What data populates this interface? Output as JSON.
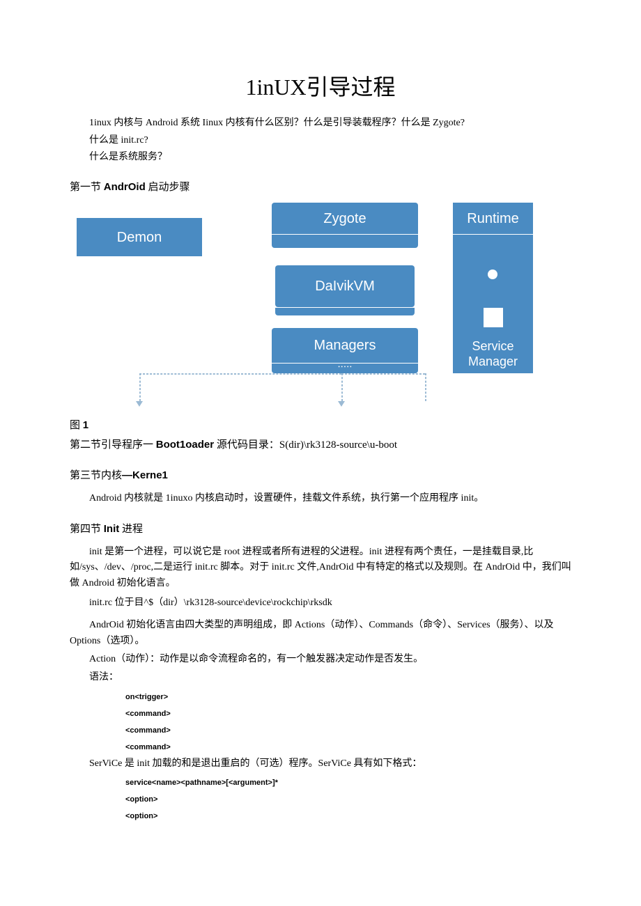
{
  "title": "1inUX引导过程",
  "intro": {
    "line1": "1inux 内核与 Android 系统 Iinux 内核有什么区别？什么是引导装载程序？什么是 Zygote?",
    "line2": "什么是 init.rc?",
    "line3": "什么是系统服务？"
  },
  "section1": {
    "prefix": "第一节 ",
    "bold": "AndrOid",
    "suffix": " 启动步骤"
  },
  "diagram": {
    "demon": "Demon",
    "zygote": "Zygote",
    "dalvik": "DaIvikVM",
    "managers": "Managers",
    "runtime": "Runtime",
    "service": "Service",
    "manager": "Manager"
  },
  "fig1": {
    "prefix": "图 ",
    "bold": "1"
  },
  "section2": {
    "prefix": "第二节引导程序一 ",
    "bold": "Boot1oader",
    "suffix": " 源代码目录：S(dir)\\rk3128-source\\u-boot"
  },
  "section3": {
    "prefix": "第三节内核",
    "bold": "—Kerne1"
  },
  "section3_body": "Android 内核就是 1inuxo 内核启动时，设置硬件，挂载文件系统，执行第一个应用程序 init。",
  "section4": {
    "prefix": "第四节 ",
    "bold": "Init",
    "suffix": " 进程"
  },
  "section4_p1": "init 是第一个进程，可以说它是 root 进程或者所有进程的父进程。init 进程有两个责任，一是挂载目录,比如/sys、/dev、/proc,二是运行 init.rc 脚本。对于 init.rc 文件,AndrOid 中有特定的格式以及规则。在 AndrOid 中，我们叫做 Android 初始化语言。",
  "section4_p2": "init.rc 位于目^$（dir）\\rk3128-source\\device\\rockchip\\rksdk",
  "section4_p3": "AndrOid 初始化语言由四大类型的声明组成，即 Actions（动作）、Commands（命令）、Services（服务）、以及 Options（选项）。",
  "section4_p4": "Action（动作）：动作是以命令流程命名的，有一个触发器决定动作是否发生。",
  "section4_p5": "语法：",
  "code1": {
    "l1": "on<trigger>",
    "l2": "<command>",
    "l3": "<command>",
    "l4": "<command>"
  },
  "section4_p6": "SerViCe 是 init 加载的和是退出重启的（可选）程序。SerViCe 具有如下格式：",
  "code2": {
    "l1": "service<name><pathname>[<argument>]*",
    "l2": "<option>",
    "l3": "<option>"
  }
}
